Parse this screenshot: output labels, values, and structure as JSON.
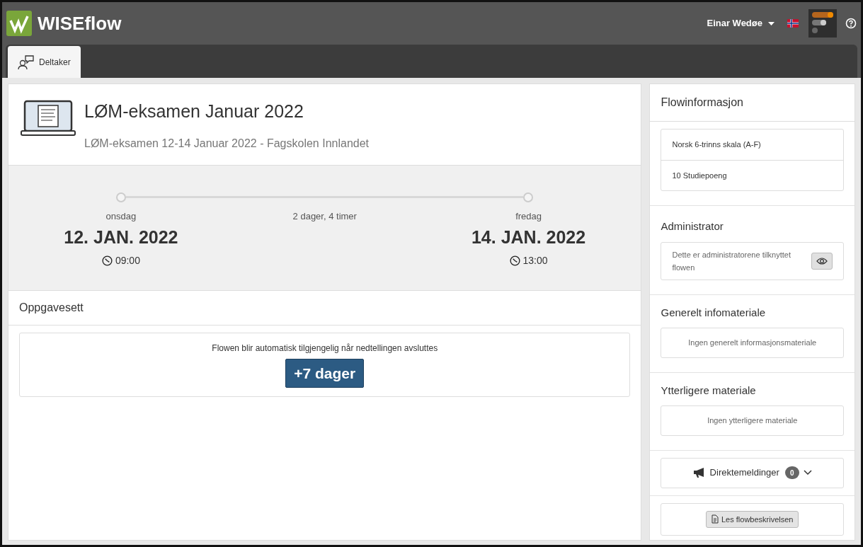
{
  "header": {
    "logo_text": "WISEflow",
    "user_name": "Einar Wedøe"
  },
  "tabs": [
    {
      "label": "Deltaker",
      "selected": true
    }
  ],
  "flow": {
    "title": "LØM-eksamen Januar 2022",
    "subtitle": "LØM-eksamen 12-14 Januar 2022 - Fagskolen Innlandet",
    "start": {
      "weekday": "onsdag",
      "date": "12. JAN. 2022",
      "time": "09:00"
    },
    "duration": "2 dager, 4 timer",
    "end": {
      "weekday": "fredag",
      "date": "14. JAN. 2022",
      "time": "13:00"
    }
  },
  "assignment_set": {
    "title": "Oppgavesett",
    "message": "Flowen blir automatisk tilgjengelig når nedtellingen avsluttes",
    "countdown": "+7 dager"
  },
  "sidebar": {
    "flow_info": {
      "title": "Flowinformasjon",
      "items": [
        "Norsk 6-trinns skala (A-F)",
        "10 Studiepoeng"
      ]
    },
    "administrator": {
      "title": "Administrator",
      "text": "Dette er administratorene tilknyttet flowen"
    },
    "general_material": {
      "title": "Generelt infomateriale",
      "text": "Ingen generelt informasjonsmateriale"
    },
    "additional_material": {
      "title": "Ytterligere materiale",
      "text": "Ingen ytterligere materiale"
    },
    "direct_messages": {
      "label": "Direktemeldinger",
      "count": "0",
      "expanded": false
    },
    "description_button": "Les flowbeskrivelsen"
  }
}
